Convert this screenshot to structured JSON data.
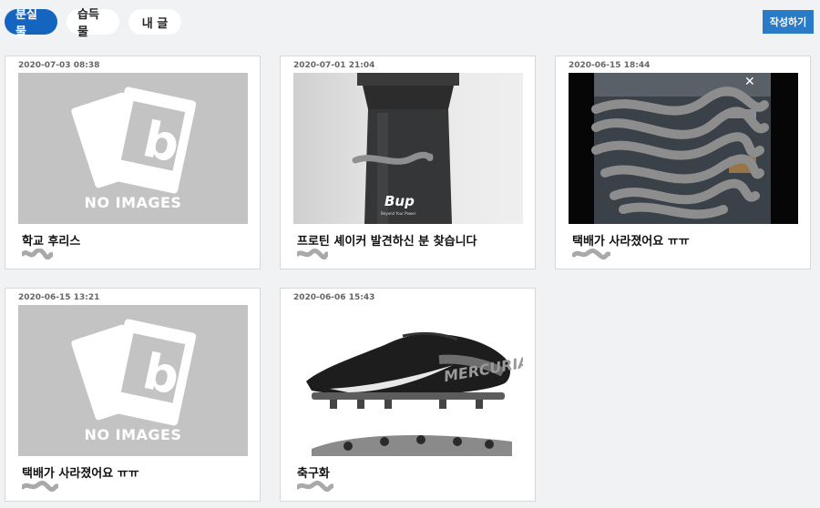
{
  "tabs": [
    {
      "label": "분실물",
      "active": true
    },
    {
      "label": "습득물",
      "active": false
    },
    {
      "label": "내 글",
      "active": false
    }
  ],
  "write_button": "작성하기",
  "no_image_text": "NO IMAGES",
  "close_glyph": "✕",
  "bottle_brand": "Bup",
  "bottle_tagline": "Beyond Your Power",
  "shoe_text": "MERCURIAL",
  "posts": [
    {
      "date": "2020-07-03 08:38",
      "title": "학교 후리스",
      "image": "no-image"
    },
    {
      "date": "2020-07-01 21:04",
      "title": "프로틴 셰이커 발견하신 분 찾습니다",
      "image": "shaker-photo"
    },
    {
      "date": "2020-06-15 18:44",
      "title": "택배가 사라졌어요 ㅠㅠ",
      "image": "scribbled-screenshot"
    },
    {
      "date": "2020-06-15 13:21",
      "title": "택배가 사라졌어요 ㅠㅠ",
      "image": "no-image"
    },
    {
      "date": "2020-06-06 15:43",
      "title": "축구화",
      "image": "soccer-shoes-photo"
    }
  ],
  "colors": {
    "accent": "#1565c0",
    "button": "#2a7bc7",
    "background": "#f1f2f4",
    "placeholder": "#c3c3c3"
  }
}
